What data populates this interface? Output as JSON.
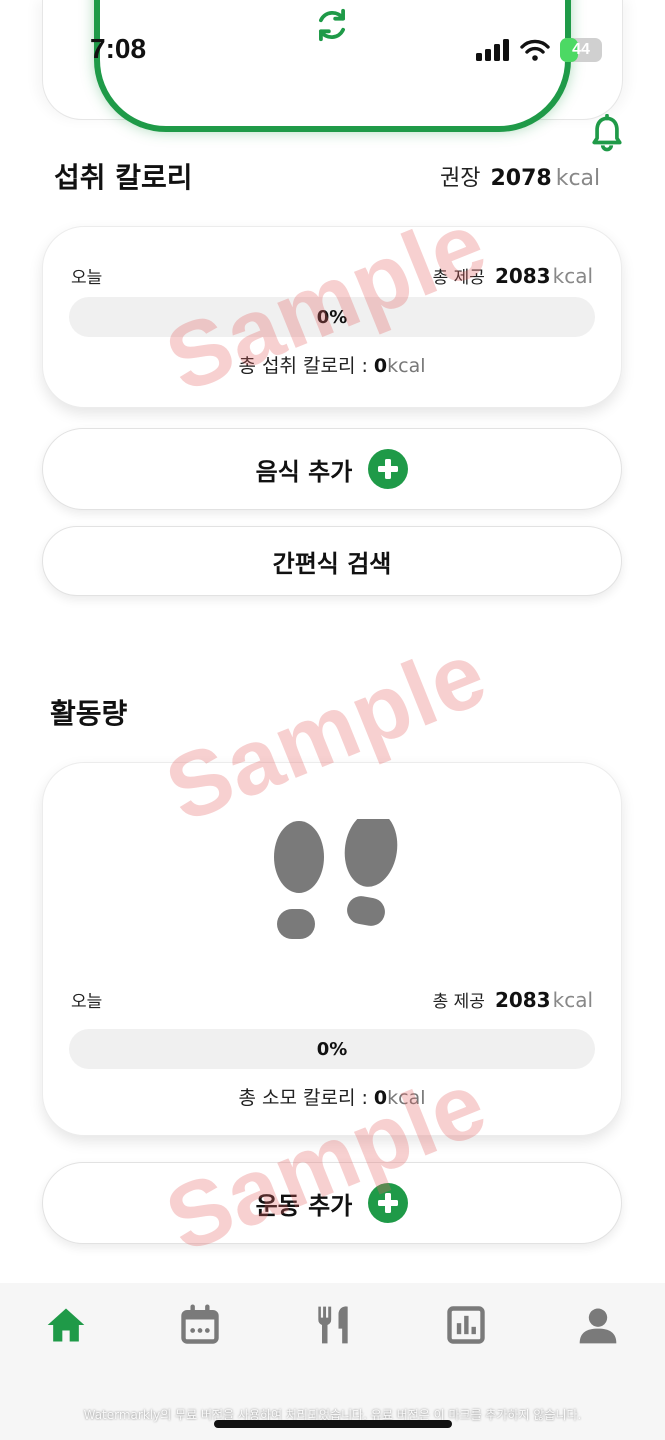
{
  "status_bar": {
    "time": "7:08",
    "battery": "44",
    "battery_fraction": 0.44
  },
  "intake": {
    "title": "섭취 칼로리",
    "recommended_label": "권장",
    "recommended_value": "2078",
    "recommended_unit": "kcal",
    "card": {
      "day_label": "오늘",
      "provide_label": "총 제공",
      "provide_value": "2083",
      "provide_unit": "kcal",
      "progress_text": "0%",
      "progress_fraction": 0,
      "total_label": "총 섭취 칼로리 : ",
      "total_value": "0",
      "total_unit": "kcal"
    },
    "add_food_label": "음식 추가",
    "snack_search_label": "간편식 검색"
  },
  "activity": {
    "title": "활동량",
    "card": {
      "day_label": "오늘",
      "provide_label": "총 제공",
      "provide_value": "2083",
      "provide_unit": "kcal",
      "progress_text": "0%",
      "progress_fraction": 0,
      "total_label": "총 소모 칼로리 : ",
      "total_value": "0",
      "total_unit": "kcal"
    },
    "add_exercise_label": "운동 추가"
  },
  "watermark_text": "Sample",
  "footer_note": "Watermarkly의 무료 버전을 사용하여 처리되었습니다. 유료 버전은 이 마크를 추가하지 않습니다.",
  "nav": {
    "items": [
      {
        "icon": "home-icon",
        "active": true
      },
      {
        "icon": "calendar-icon",
        "active": false
      },
      {
        "icon": "utensils-icon",
        "active": false
      },
      {
        "icon": "chart-icon",
        "active": false
      },
      {
        "icon": "profile-icon",
        "active": false
      }
    ]
  },
  "colors": {
    "accent": "#1f9a48",
    "inactive_icon": "#7a7a7a",
    "progress_track": "#f0f0f0"
  }
}
